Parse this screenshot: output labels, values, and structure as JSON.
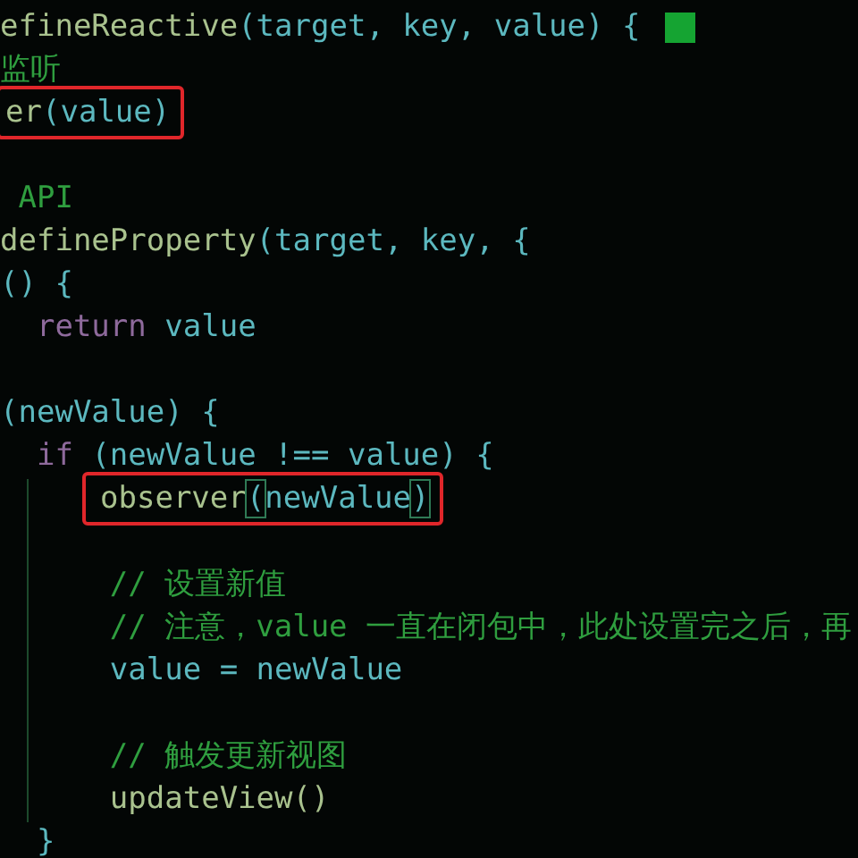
{
  "code_lines": [
    {
      "kind": "code",
      "boxed": false,
      "cursor": true,
      "tokens": [
        {
          "text": "efineReactive",
          "kind": "func"
        },
        {
          "text": "(target, key, value) {",
          "kind": "ident"
        }
      ]
    },
    {
      "kind": "code",
      "boxed": false,
      "cursor": false,
      "tokens": [
        {
          "text": "监听",
          "kind": "comment"
        }
      ]
    },
    {
      "kind": "code",
      "boxed": true,
      "cursor": false,
      "tokens": [
        {
          "text": "er",
          "kind": "func"
        },
        {
          "text": "(value)",
          "kind": "ident"
        }
      ]
    },
    {
      "kind": "blank"
    },
    {
      "kind": "code",
      "boxed": false,
      "cursor": false,
      "tokens": [
        {
          "text": " API",
          "kind": "comment"
        }
      ]
    },
    {
      "kind": "code",
      "boxed": false,
      "cursor": false,
      "tokens": [
        {
          "text": "defineProperty",
          "kind": "func"
        },
        {
          "text": "(target, key, {",
          "kind": "ident"
        }
      ]
    },
    {
      "kind": "code",
      "boxed": false,
      "cursor": false,
      "tokens": [
        {
          "text": "() {",
          "kind": "ident"
        }
      ]
    },
    {
      "kind": "code",
      "boxed": false,
      "cursor": false,
      "tokens": [
        {
          "text": "  return",
          "kind": "keyword"
        },
        {
          "text": " value",
          "kind": "ident"
        }
      ]
    },
    {
      "kind": "blank"
    },
    {
      "kind": "code",
      "boxed": false,
      "cursor": false,
      "tokens": [
        {
          "text": "(newValue) {",
          "kind": "ident"
        }
      ]
    },
    {
      "kind": "code",
      "boxed": false,
      "cursor": false,
      "tokens": [
        {
          "text": "  if",
          "kind": "keyword"
        },
        {
          "text": " (newValue !== value) {",
          "kind": "ident"
        }
      ]
    },
    {
      "kind": "code",
      "boxed": true,
      "cursor": false,
      "tokens": [
        {
          "text": "observer",
          "kind": "func"
        },
        {
          "text": "(",
          "kind": "ident",
          "matched": true
        },
        {
          "text": "newValue",
          "kind": "ident"
        },
        {
          "text": ")",
          "kind": "ident",
          "matched": true
        }
      ]
    },
    {
      "kind": "blank"
    },
    {
      "kind": "code",
      "boxed": false,
      "cursor": false,
      "tokens": [
        {
          "text": "      // 设置新值",
          "kind": "comment"
        }
      ]
    },
    {
      "kind": "code",
      "boxed": false,
      "cursor": false,
      "tokens": [
        {
          "text": "      // 注意，value 一直在闭包中，此处设置完之后，再",
          "kind": "comment"
        }
      ]
    },
    {
      "kind": "code",
      "boxed": false,
      "cursor": false,
      "tokens": [
        {
          "text": "      value = newValue",
          "kind": "ident"
        }
      ]
    },
    {
      "kind": "blank"
    },
    {
      "kind": "code",
      "boxed": false,
      "cursor": false,
      "tokens": [
        {
          "text": "      // 触发更新视图",
          "kind": "comment"
        }
      ]
    },
    {
      "kind": "code",
      "boxed": false,
      "cursor": false,
      "tokens": [
        {
          "text": "      updateView()",
          "kind": "func"
        }
      ]
    },
    {
      "kind": "code",
      "boxed": false,
      "cursor": false,
      "tokens": [
        {
          "text": "  }",
          "kind": "ident"
        }
      ]
    }
  ]
}
